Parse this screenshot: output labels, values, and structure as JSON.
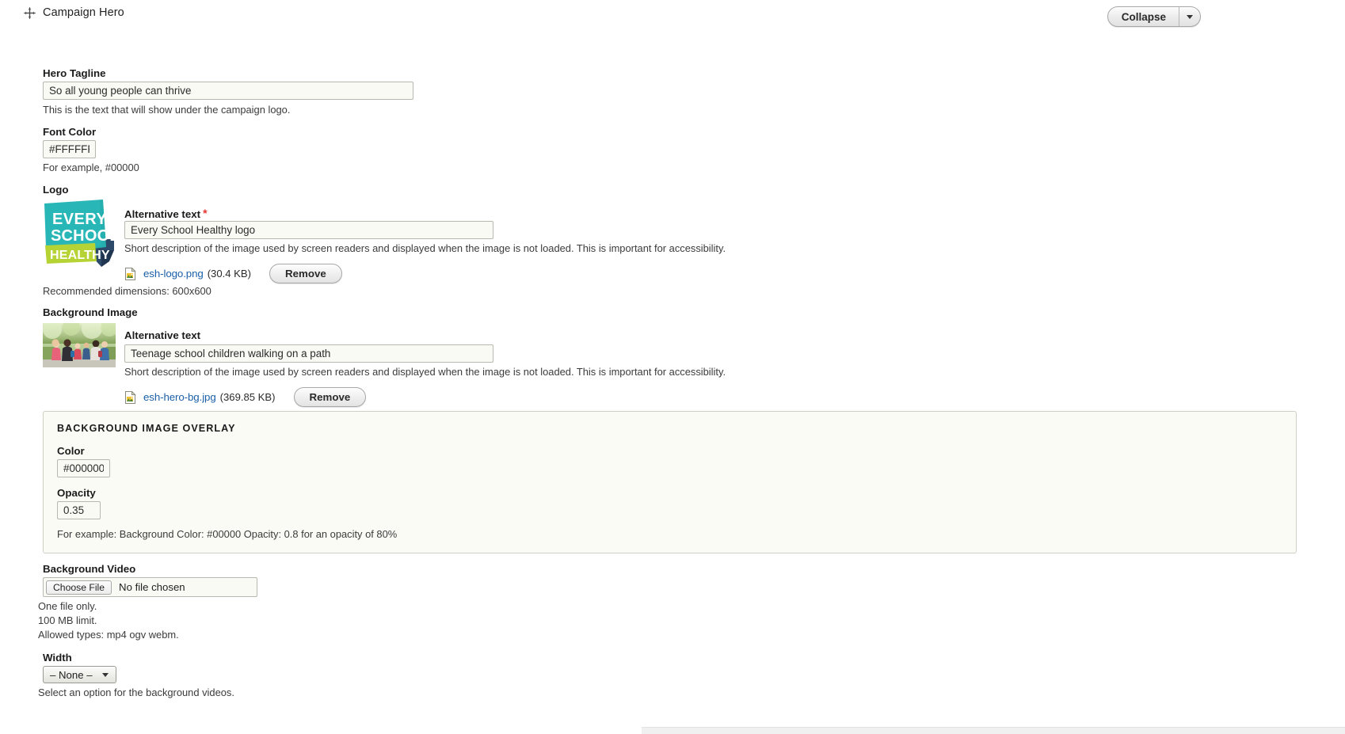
{
  "header": {
    "drag_icon": "move-cross-icon",
    "title": "Campaign Hero",
    "collapse_label": "Collapse",
    "collapse_caret_icon": "chevron-down-icon"
  },
  "fields": {
    "tagline": {
      "label": "Hero Tagline",
      "value": "So all young people can thrive",
      "description": "This is the text that will show under the campaign logo."
    },
    "font_color": {
      "label": "Font Color",
      "value": "#FFFFFF",
      "description": "For example, #00000"
    },
    "logo": {
      "label": "Logo",
      "alt_label": "Alternative text",
      "required_marker": "*",
      "alt_value": "Every School Healthy logo",
      "alt_description": "Short description of the image used by screen readers and displayed when the image is not loaded. This is important for accessibility.",
      "file_icon": "image-file-icon",
      "file_name": "esh-logo.png",
      "file_size": "(30.4 KB)",
      "remove_label": "Remove",
      "dimensions_note": "Recommended dimensions: 600x600",
      "logo_text_line1": "EVERY",
      "logo_text_line2": "SCHOOL",
      "logo_text_line3": "HEALTHY",
      "logo_teal": "#29b6b6",
      "logo_green": "#b5d334",
      "logo_navy": "#2e4a6b"
    },
    "background_image": {
      "label": "Background Image",
      "alt_label": "Alternative text",
      "alt_value": "Teenage school children walking on a path",
      "alt_description": "Short description of the image used by screen readers and displayed when the image is not loaded. This is important for accessibility.",
      "file_icon": "image-file-icon",
      "file_name": "esh-hero-bg.jpg",
      "file_size": "(369.85 KB)",
      "remove_label": "Remove"
    },
    "overlay": {
      "legend": "BACKGROUND IMAGE OVERLAY",
      "color_label": "Color",
      "color_value": "#000000",
      "opacity_label": "Opacity",
      "opacity_value": "0.35",
      "description": "For example: Background Color: #00000 Opacity: 0.8 for an opacity of 80%"
    },
    "background_video": {
      "label": "Background Video",
      "choose_label": "Choose File",
      "no_file_text": "No file chosen",
      "desc_one_file": "One file only.",
      "desc_limit": "100 MB limit.",
      "desc_types": "Allowed types: mp4 ogv webm."
    },
    "width": {
      "label": "Width",
      "selected": "– None –",
      "arrow_icon": "chevron-down-icon",
      "description": "Select an option for the background videos."
    }
  }
}
